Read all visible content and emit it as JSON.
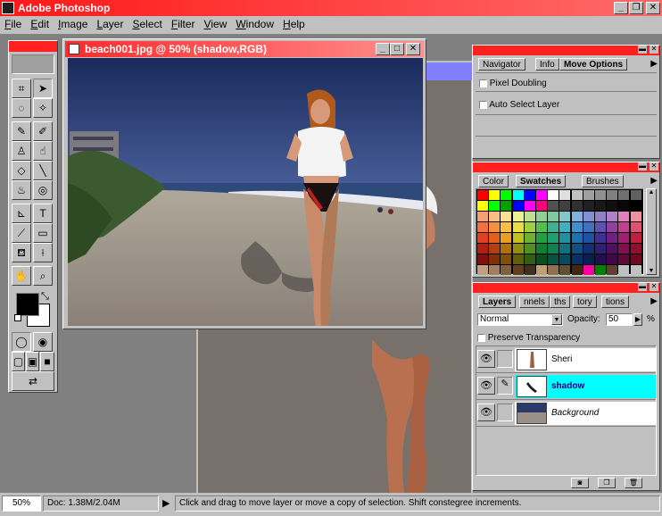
{
  "app": {
    "title": "Adobe Photoshop"
  },
  "menu": [
    "File",
    "Edit",
    "Image",
    "Layer",
    "Select",
    "Filter",
    "View",
    "Window",
    "Help"
  ],
  "image_window": {
    "title": "beach001.jpg @ 50% (shadow,RGB)"
  },
  "navigator_palette": {
    "tabs": [
      "Navigator",
      "Info",
      "Move Options"
    ],
    "options": [
      "Pixel Doubling",
      "Auto Select Layer"
    ]
  },
  "swatches_palette": {
    "tabs": [
      "Color",
      "Swatches",
      "Brushes"
    ],
    "colors": [
      [
        "#ff0000",
        "#ffff00",
        "#00ff00",
        "#00ffff",
        "#0000ff",
        "#ff00ff",
        "#ffffff",
        "#e0e0e0",
        "#c0c0c0",
        "#a0a0a0",
        "#909090",
        "#808080",
        "#707070",
        "#606060"
      ],
      [
        "#ffff00",
        "#00ff00",
        "#00a000",
        "#0000ff",
        "#ff00ff",
        "#ff0080",
        "#505050",
        "#404040",
        "#303030",
        "#202020",
        "#181818",
        "#101010",
        "#080808",
        "#000000"
      ],
      [
        "#f4a070",
        "#f8c080",
        "#fce090",
        "#f0f090",
        "#c0e090",
        "#90d090",
        "#80c8a0",
        "#80c8c8",
        "#80b0e0",
        "#8090d0",
        "#9080c8",
        "#b080c8",
        "#e080c0",
        "#f090a0"
      ],
      [
        "#f07040",
        "#f49040",
        "#f8c040",
        "#e8e040",
        "#a0d040",
        "#50c050",
        "#40b090",
        "#40b0c0",
        "#4090d0",
        "#4070c0",
        "#6050b0",
        "#9040a0",
        "#c04090",
        "#e05070"
      ],
      [
        "#e04020",
        "#e06020",
        "#e8a020",
        "#c0c020",
        "#70b030",
        "#20a040",
        "#20a070",
        "#2090a0",
        "#2070b0",
        "#2050a0",
        "#403090",
        "#702080",
        "#a02070",
        "#c02040"
      ],
      [
        "#b02010",
        "#b04010",
        "#b07010",
        "#909010",
        "#509020",
        "#108030",
        "#108050",
        "#107080",
        "#105080",
        "#103070",
        "#302070",
        "#501060",
        "#801050",
        "#901030"
      ],
      [
        "#801008",
        "#803008",
        "#805008",
        "#606008",
        "#306010",
        "#085020",
        "#085040",
        "#084860",
        "#083060",
        "#082050",
        "#201050",
        "#400848",
        "#600838",
        "#700820"
      ],
      [
        "#c0a080",
        "#a08060",
        "#806040",
        "#604020",
        "#403020",
        "#c0a070",
        "#907050",
        "#605030",
        "#402810",
        "#ff00a0",
        "#008000",
        "#604030",
        "#c0c0c0",
        "#c0c0c0"
      ]
    ]
  },
  "layers_palette": {
    "tabs": [
      "Layers",
      "nnels",
      "ths",
      "tory",
      "tions"
    ],
    "blend_mode": "Normal",
    "opacity_label": "Opacity:",
    "opacity_value": "50",
    "opacity_unit": "%",
    "preserve_transparency": "Preserve Transparency",
    "layers": [
      {
        "name": "Sheri",
        "selected": false
      },
      {
        "name": "shadow",
        "selected": true
      },
      {
        "name": "Background",
        "selected": false
      }
    ]
  },
  "status": {
    "zoom": "50%",
    "doc": "Doc: 1.38M/2.04M",
    "hint": "Click and drag to move layer or move a copy of selection. Shift constegree increments."
  }
}
